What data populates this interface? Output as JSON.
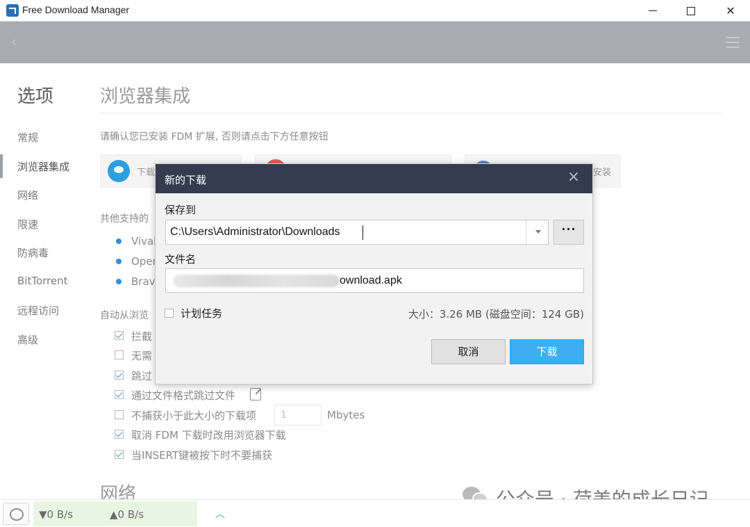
{
  "window": {
    "title": "Free Download Manager"
  },
  "nav": {
    "title": "选项",
    "items": [
      {
        "label": "常规"
      },
      {
        "label": "浏览器集成"
      },
      {
        "label": "网络"
      },
      {
        "label": "限速"
      },
      {
        "label": "防病毒"
      },
      {
        "label": "BitTorrent"
      },
      {
        "label": "远程访问"
      },
      {
        "label": "高级"
      }
    ],
    "active": "浏览器集成"
  },
  "content": {
    "section_title": "浏览器集成",
    "intro": "请确认您已安装 FDM 扩展, 否则请点击下方任意按钮",
    "browser_buttons": [
      {
        "label": "下载"
      },
      {
        "label": ""
      },
      {
        "label": "安装"
      }
    ],
    "other_supported_label": "共他支持的",
    "other_browsers": [
      "Vival",
      "Oper",
      "Brave"
    ],
    "auto_label": "自动从浏览",
    "options": [
      {
        "label": "拦截",
        "checked": true
      },
      {
        "label": "无需",
        "checked": false
      },
      {
        "label": "跳过",
        "checked": true
      },
      {
        "label": "通过文件格式跳过文件",
        "checked": true
      },
      {
        "label": "不捕获小于此大小的下载项",
        "checked": false
      },
      {
        "label": "取消 FDM 下载时改用浏览器下载",
        "checked": true
      },
      {
        "label": "当INSERT键被按下时不要捕获",
        "checked": true
      }
    ],
    "min_size_value": "1",
    "min_size_unit": "Mbytes",
    "next_section_title": "网络"
  },
  "statusbar": {
    "download_speed": "▼0 B/s",
    "upload_speed": "▲0 B/s"
  },
  "watermark": {
    "text": "公众号 · 荷美的成长日记"
  },
  "dialog": {
    "title": "新的下载",
    "save_to_label": "保存到",
    "save_path": "C:\\Users\\Administrator\\Downloads",
    "browse_label": "···",
    "filename_label": "文件名",
    "filename_suffix": "ownload.apk",
    "schedule_label": "计划任务",
    "schedule_checked": false,
    "size_info": "大小：3.26 MB (磁盘空间：124 GB)",
    "cancel_label": "取消",
    "download_label": "下载"
  }
}
